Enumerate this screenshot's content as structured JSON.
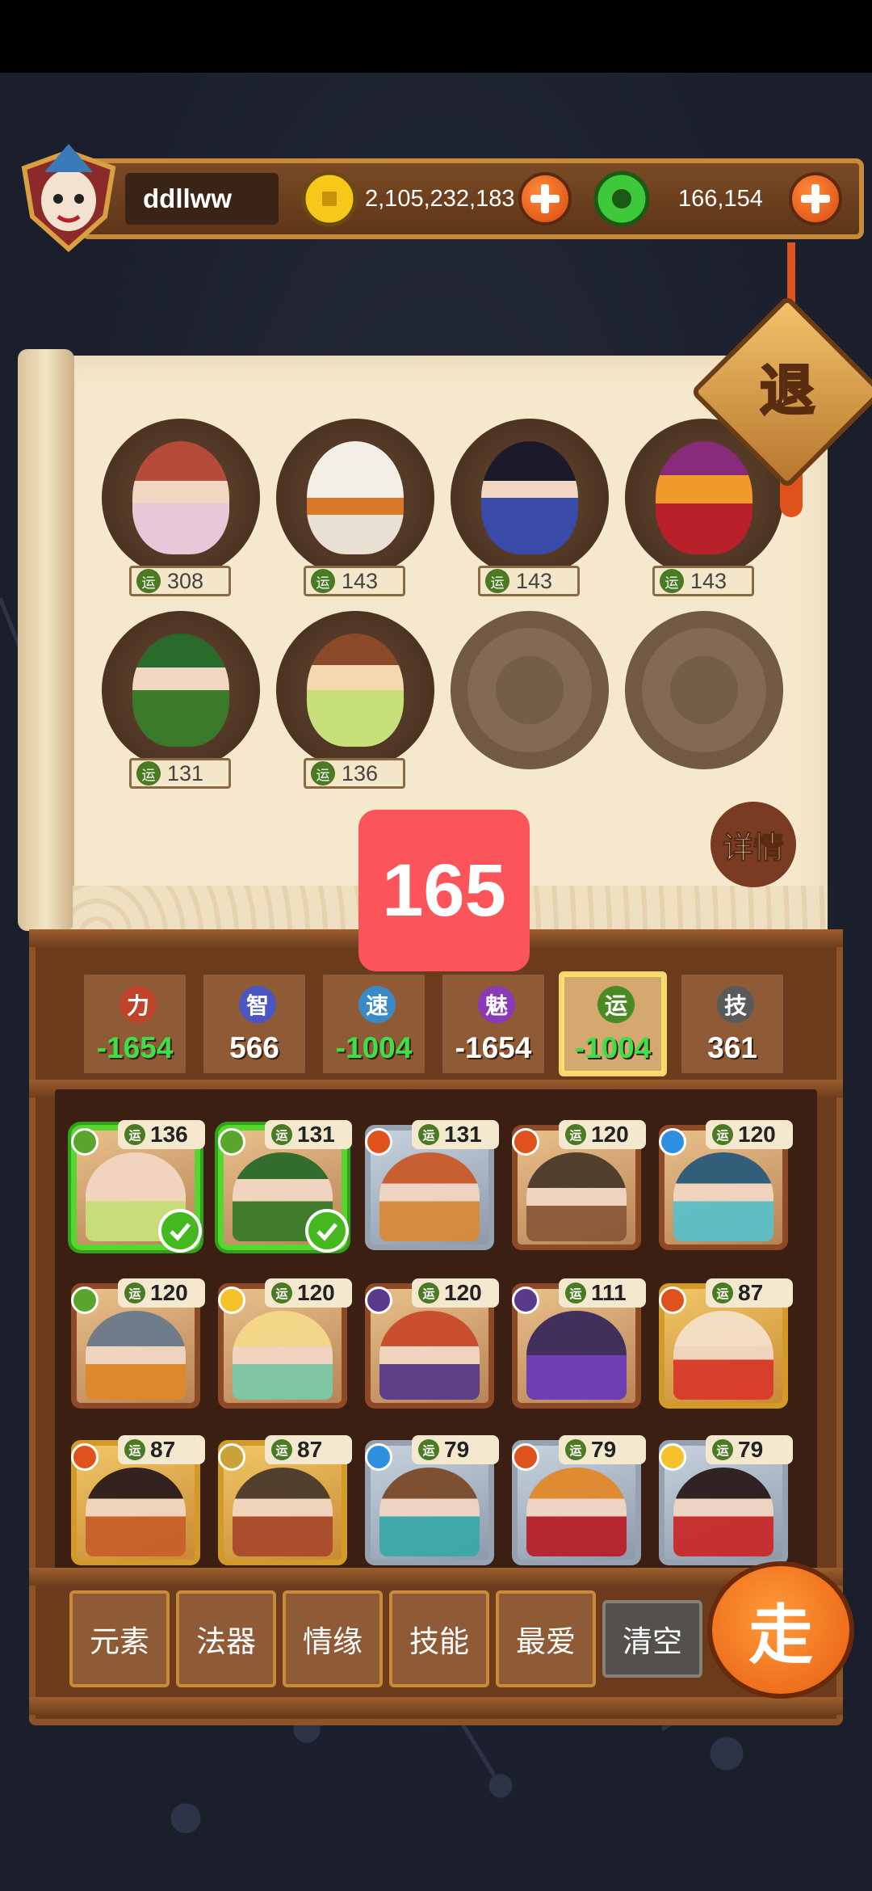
{
  "header": {
    "username": "ddllww",
    "gold": "2,105,232,183",
    "jade": "166,154"
  },
  "buttons": {
    "exit": "退",
    "details": "详情",
    "go": "走"
  },
  "total_badge": "165",
  "luck_chip": "运",
  "team_slots": [
    {
      "value": "308",
      "filled": true
    },
    {
      "value": "143",
      "filled": true
    },
    {
      "value": "143",
      "filled": true
    },
    {
      "value": "143",
      "filled": true
    },
    {
      "value": "131",
      "filled": true
    },
    {
      "value": "136",
      "filled": true
    },
    {
      "filled": false
    },
    {
      "filled": false
    }
  ],
  "stats": [
    {
      "name": "力",
      "value": "-1654",
      "negative": true,
      "color": "#c0442a"
    },
    {
      "name": "智",
      "value": "566",
      "negative": false,
      "color": "#4a56c2"
    },
    {
      "name": "速",
      "value": "-1004",
      "negative": true,
      "color": "#3a8ac8"
    },
    {
      "name": "魅",
      "value": "-1654",
      "negative": false,
      "color": "#8a3ab8"
    },
    {
      "name": "运",
      "value": "-1004",
      "negative": true,
      "color": "#4a8a24",
      "active": true
    },
    {
      "name": "技",
      "value": "361",
      "negative": false,
      "color": "#5a5a5a"
    }
  ],
  "cards": [
    {
      "value": "136",
      "element": "wood",
      "style": "selected"
    },
    {
      "value": "131",
      "element": "wood",
      "style": "selected"
    },
    {
      "value": "131",
      "element": "fire",
      "style": "silver"
    },
    {
      "value": "120",
      "element": "fire",
      "style": "bronze"
    },
    {
      "value": "120",
      "element": "water",
      "style": "bronze"
    },
    {
      "value": "120",
      "element": "wood",
      "style": "bronze"
    },
    {
      "value": "120",
      "element": "light",
      "style": "bronze"
    },
    {
      "value": "120",
      "element": "dark",
      "style": "bronze"
    },
    {
      "value": "111",
      "element": "dark",
      "style": "bronze"
    },
    {
      "value": "87",
      "element": "fire",
      "style": "gold"
    },
    {
      "value": "87",
      "element": "fire",
      "style": "gold"
    },
    {
      "value": "87",
      "element": "earth",
      "style": "gold"
    },
    {
      "value": "79",
      "element": "water",
      "style": "silver"
    },
    {
      "value": "79",
      "element": "fire",
      "style": "silver"
    },
    {
      "value": "79",
      "element": "light",
      "style": "silver"
    }
  ],
  "filters": [
    "元素",
    "法器",
    "情缘",
    "技能",
    "最爱",
    "清空"
  ],
  "colors": {
    "wood": "#5aa52c",
    "fire": "#e0521c",
    "water": "#2f8fe0",
    "light": "#f5c22a",
    "dark": "#5a3a8a",
    "earth": "#c9a23a",
    "badge": "#fb545a"
  }
}
